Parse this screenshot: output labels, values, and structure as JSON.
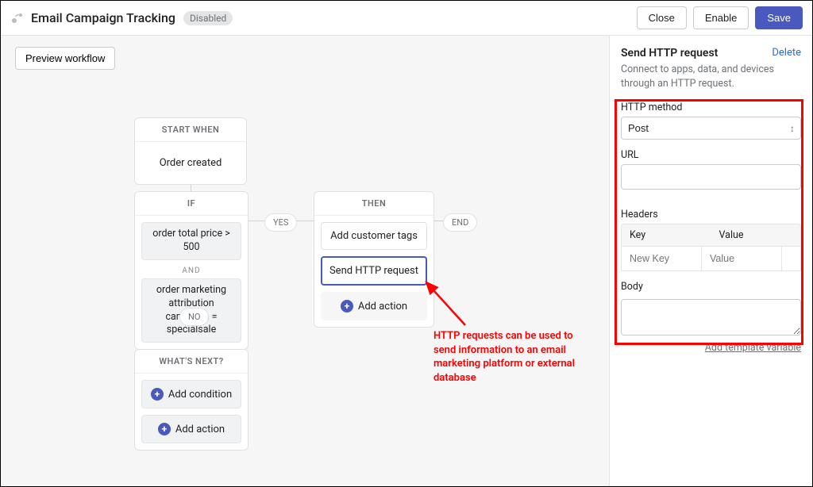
{
  "header": {
    "title": "Email Campaign Tracking",
    "status_chip": "Disabled",
    "close": "Close",
    "enable": "Enable",
    "save": "Save"
  },
  "toolbar": {
    "preview": "Preview workflow"
  },
  "flow": {
    "start": {
      "header": "START WHEN",
      "trigger": "Order created"
    },
    "if": {
      "header": "IF",
      "cond1": "order total price > 500",
      "and": "AND",
      "cond2": "order marketing attribution campaign = specialsale"
    },
    "yes": "YES",
    "no": "NO",
    "end": "END",
    "then": {
      "header": "THEN",
      "action1": "Add customer tags",
      "action2": "Send HTTP request",
      "add_action": "Add action"
    },
    "next": {
      "header": "WHAT'S NEXT?",
      "add_condition": "Add condition",
      "add_action": "Add action"
    }
  },
  "panel": {
    "title": "Send HTTP request",
    "delete": "Delete",
    "description": "Connect to apps, data, and devices through an HTTP request.",
    "method_label": "HTTP method",
    "method_value": "Post",
    "url_label": "URL",
    "url_value": "",
    "headers_label": "Headers",
    "headers_key": "Key",
    "headers_value": "Value",
    "headers_newkey_ph": "New Key",
    "headers_newval_ph": "Value",
    "body_label": "Body",
    "body_value": "",
    "add_template_var": "Add template variable"
  },
  "annotation": {
    "text": "HTTP requests can be used to send information to an email marketing platform or external database"
  }
}
